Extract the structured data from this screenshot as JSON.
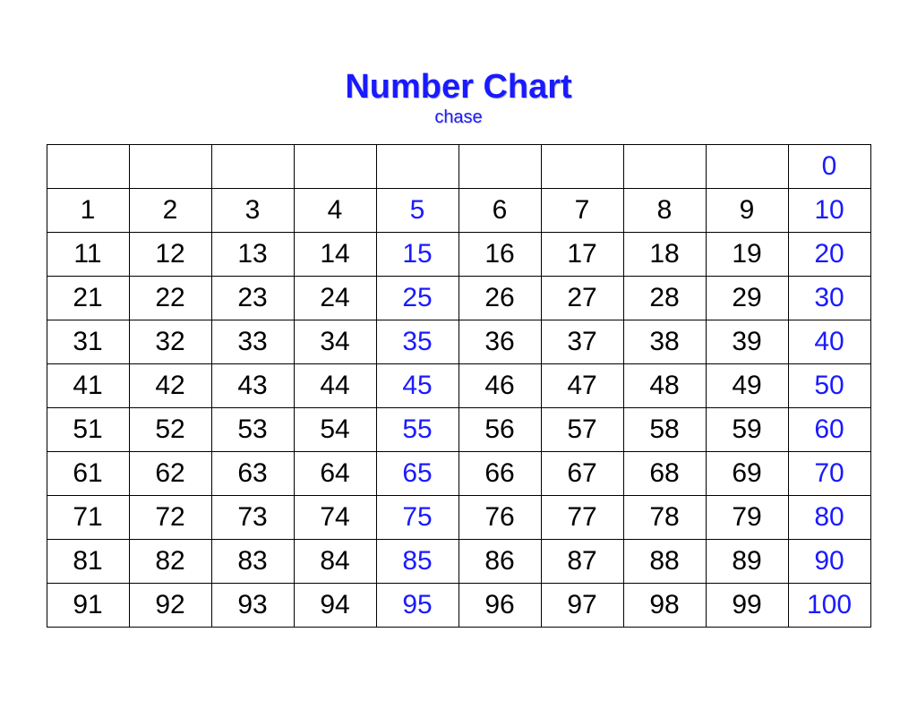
{
  "title": "Number Chart",
  "subtitle": "chase",
  "chart_data": {
    "type": "table",
    "title": "Number Chart",
    "columns": 10,
    "rows": [
      [
        {
          "v": "",
          "hi": false
        },
        {
          "v": "",
          "hi": false
        },
        {
          "v": "",
          "hi": false
        },
        {
          "v": "",
          "hi": false
        },
        {
          "v": "",
          "hi": false
        },
        {
          "v": "",
          "hi": false
        },
        {
          "v": "",
          "hi": false
        },
        {
          "v": "",
          "hi": false
        },
        {
          "v": "",
          "hi": false
        },
        {
          "v": "0",
          "hi": true
        }
      ],
      [
        {
          "v": "1",
          "hi": false
        },
        {
          "v": "2",
          "hi": false
        },
        {
          "v": "3",
          "hi": false
        },
        {
          "v": "4",
          "hi": false
        },
        {
          "v": "5",
          "hi": true
        },
        {
          "v": "6",
          "hi": false
        },
        {
          "v": "7",
          "hi": false
        },
        {
          "v": "8",
          "hi": false
        },
        {
          "v": "9",
          "hi": false
        },
        {
          "v": "10",
          "hi": true
        }
      ],
      [
        {
          "v": "11",
          "hi": false
        },
        {
          "v": "12",
          "hi": false
        },
        {
          "v": "13",
          "hi": false
        },
        {
          "v": "14",
          "hi": false
        },
        {
          "v": "15",
          "hi": true
        },
        {
          "v": "16",
          "hi": false
        },
        {
          "v": "17",
          "hi": false
        },
        {
          "v": "18",
          "hi": false
        },
        {
          "v": "19",
          "hi": false
        },
        {
          "v": "20",
          "hi": true
        }
      ],
      [
        {
          "v": "21",
          "hi": false
        },
        {
          "v": "22",
          "hi": false
        },
        {
          "v": "23",
          "hi": false
        },
        {
          "v": "24",
          "hi": false
        },
        {
          "v": "25",
          "hi": true
        },
        {
          "v": "26",
          "hi": false
        },
        {
          "v": "27",
          "hi": false
        },
        {
          "v": "28",
          "hi": false
        },
        {
          "v": "29",
          "hi": false
        },
        {
          "v": "30",
          "hi": true
        }
      ],
      [
        {
          "v": "31",
          "hi": false
        },
        {
          "v": "32",
          "hi": false
        },
        {
          "v": "33",
          "hi": false
        },
        {
          "v": "34",
          "hi": false
        },
        {
          "v": "35",
          "hi": true
        },
        {
          "v": "36",
          "hi": false
        },
        {
          "v": "37",
          "hi": false
        },
        {
          "v": "38",
          "hi": false
        },
        {
          "v": "39",
          "hi": false
        },
        {
          "v": "40",
          "hi": true
        }
      ],
      [
        {
          "v": "41",
          "hi": false
        },
        {
          "v": "42",
          "hi": false
        },
        {
          "v": "43",
          "hi": false
        },
        {
          "v": "44",
          "hi": false
        },
        {
          "v": "45",
          "hi": true
        },
        {
          "v": "46",
          "hi": false
        },
        {
          "v": "47",
          "hi": false
        },
        {
          "v": "48",
          "hi": false
        },
        {
          "v": "49",
          "hi": false
        },
        {
          "v": "50",
          "hi": true
        }
      ],
      [
        {
          "v": "51",
          "hi": false
        },
        {
          "v": "52",
          "hi": false
        },
        {
          "v": "53",
          "hi": false
        },
        {
          "v": "54",
          "hi": false
        },
        {
          "v": "55",
          "hi": true
        },
        {
          "v": "56",
          "hi": false
        },
        {
          "v": "57",
          "hi": false
        },
        {
          "v": "58",
          "hi": false
        },
        {
          "v": "59",
          "hi": false
        },
        {
          "v": "60",
          "hi": true
        }
      ],
      [
        {
          "v": "61",
          "hi": false
        },
        {
          "v": "62",
          "hi": false
        },
        {
          "v": "63",
          "hi": false
        },
        {
          "v": "64",
          "hi": false
        },
        {
          "v": "65",
          "hi": true
        },
        {
          "v": "66",
          "hi": false
        },
        {
          "v": "67",
          "hi": false
        },
        {
          "v": "68",
          "hi": false
        },
        {
          "v": "69",
          "hi": false
        },
        {
          "v": "70",
          "hi": true
        }
      ],
      [
        {
          "v": "71",
          "hi": false
        },
        {
          "v": "72",
          "hi": false
        },
        {
          "v": "73",
          "hi": false
        },
        {
          "v": "74",
          "hi": false
        },
        {
          "v": "75",
          "hi": true
        },
        {
          "v": "76",
          "hi": false
        },
        {
          "v": "77",
          "hi": false
        },
        {
          "v": "78",
          "hi": false
        },
        {
          "v": "79",
          "hi": false
        },
        {
          "v": "80",
          "hi": true
        }
      ],
      [
        {
          "v": "81",
          "hi": false
        },
        {
          "v": "82",
          "hi": false
        },
        {
          "v": "83",
          "hi": false
        },
        {
          "v": "84",
          "hi": false
        },
        {
          "v": "85",
          "hi": true
        },
        {
          "v": "86",
          "hi": false
        },
        {
          "v": "87",
          "hi": false
        },
        {
          "v": "88",
          "hi": false
        },
        {
          "v": "89",
          "hi": false
        },
        {
          "v": "90",
          "hi": true
        }
      ],
      [
        {
          "v": "91",
          "hi": false
        },
        {
          "v": "92",
          "hi": false
        },
        {
          "v": "93",
          "hi": false
        },
        {
          "v": "94",
          "hi": false
        },
        {
          "v": "95",
          "hi": true
        },
        {
          "v": "96",
          "hi": false
        },
        {
          "v": "97",
          "hi": false
        },
        {
          "v": "98",
          "hi": false
        },
        {
          "v": "99",
          "hi": false
        },
        {
          "v": "100",
          "hi": true
        }
      ]
    ]
  }
}
